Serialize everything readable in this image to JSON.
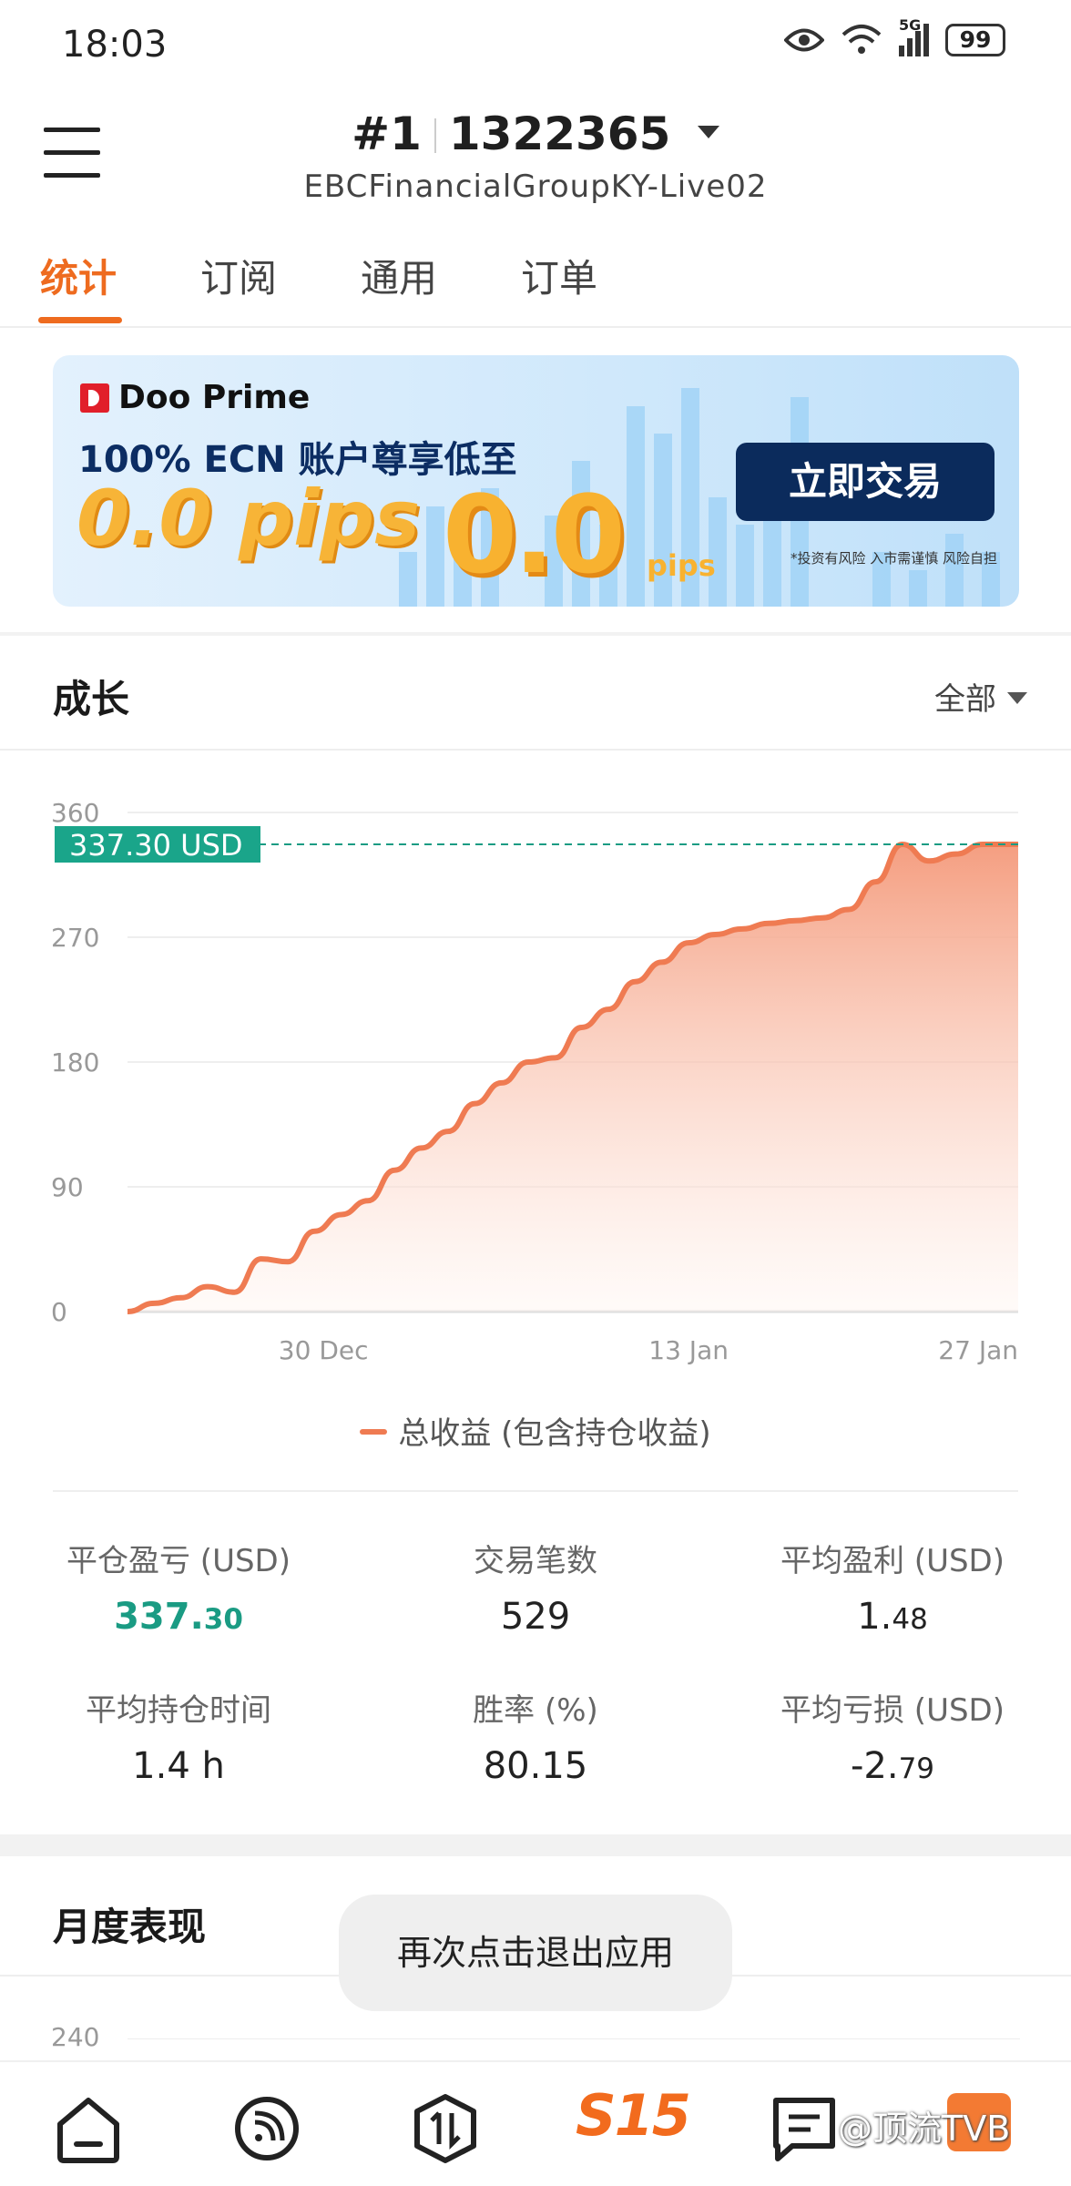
{
  "status_bar": {
    "time": "18:03",
    "network": "5G",
    "battery": "99"
  },
  "header": {
    "account_number": "#1",
    "account_id": "1322365",
    "server": "EBCFinancialGroupKY-Live02"
  },
  "tabs": [
    {
      "label": "统计",
      "active": true
    },
    {
      "label": "订阅",
      "active": false
    },
    {
      "label": "通用",
      "active": false
    },
    {
      "label": "订单",
      "active": false
    }
  ],
  "banner": {
    "brand": "Doo Prime",
    "headline": "100% ECN 账户尊享低至",
    "highlight": "0.0 pips",
    "graphic_number": "0.0",
    "graphic_unit": "pips",
    "cta": "立即交易",
    "disclaimer": "*投资有风险 入市需谨慎 风险自担"
  },
  "growth": {
    "title": "成长",
    "filter": "全部",
    "current_label": "337.30 USD",
    "legend": "总收益 (包含持仓收益)"
  },
  "chart_data": {
    "type": "area",
    "y_ticks": [
      "360",
      "270",
      "180",
      "90",
      "0"
    ],
    "x_ticks": [
      "30 Dec",
      "13 Jan",
      "27 Jan"
    ],
    "ylim": [
      0,
      360
    ],
    "grid": true,
    "x": [
      0,
      3,
      6,
      9,
      12,
      15,
      18,
      21,
      24,
      27,
      30,
      33,
      36,
      39,
      42,
      45,
      48,
      51,
      54,
      57,
      60,
      63,
      66,
      69,
      72,
      75,
      78,
      81,
      84,
      87,
      90,
      93,
      96,
      99,
      100
    ],
    "series": [
      {
        "values": [
          0,
          6,
          10,
          18,
          14,
          38,
          36,
          58,
          70,
          80,
          102,
          118,
          130,
          150,
          165,
          180,
          183,
          205,
          218,
          238,
          252,
          266,
          272,
          276,
          280,
          282,
          284,
          290,
          310,
          337,
          325,
          330,
          337,
          337,
          337
        ],
        "color": "#ef7b52"
      }
    ]
  },
  "stats": [
    {
      "label": "平仓盈亏 (USD)",
      "int": "337.",
      "dec": "30"
    },
    {
      "label": "交易笔数",
      "int": "529",
      "dec": ""
    },
    {
      "label": "平均盈利 (USD)",
      "int": "1.",
      "dec": "48"
    },
    {
      "label": "平均持仓时间",
      "int": "1.4 h",
      "dec": ""
    },
    {
      "label": "胜率 (%)",
      "int": "80.15",
      "dec": ""
    },
    {
      "label": "平均亏损 (USD)",
      "int": "-2.",
      "dec": "79"
    }
  ],
  "monthly": {
    "title": "月度表现",
    "first_tick": "240"
  },
  "toast": "再次点击退出应用",
  "bottom_nav": {
    "center_label": "S15",
    "watermark": "@顶流TVB"
  },
  "colors": {
    "accent": "#ee6b1f",
    "positive": "#1a9b83",
    "chart_line": "#ef7b52",
    "brand_navy": "#0b2b5c"
  }
}
